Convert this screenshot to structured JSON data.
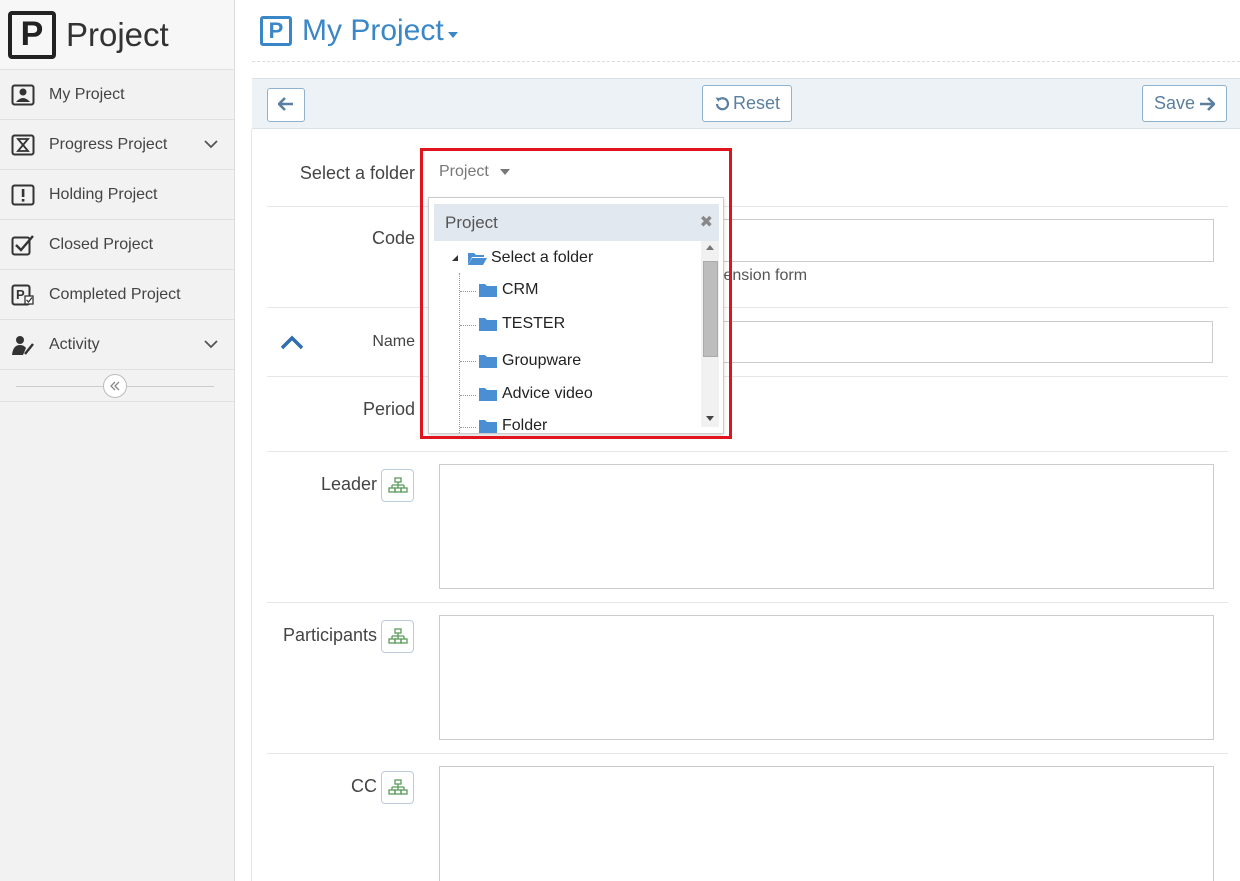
{
  "sidebar": {
    "brand_logo": "P",
    "brand_title": "Project",
    "items": [
      {
        "label": "My Project",
        "icon": "user-card-icon"
      },
      {
        "label": "Progress Project",
        "icon": "hourglass-icon",
        "expandable": true
      },
      {
        "label": "Holding Project",
        "icon": "exclamation-box-icon"
      },
      {
        "label": "Closed Project",
        "icon": "check-box-icon"
      },
      {
        "label": "Completed Project",
        "icon": "project-check-icon"
      },
      {
        "label": "Activity",
        "icon": "user-edit-icon",
        "expandable": true
      }
    ],
    "collapse_icon": "double-chevron-left-icon"
  },
  "header": {
    "logo": "P",
    "title": "My Project"
  },
  "toolbar": {
    "reset_label": "Reset",
    "save_label": "Save"
  },
  "form": {
    "folder_label": "Select a folder",
    "folder_value": "Project",
    "code_label": "Code",
    "code_hint": "tension form",
    "name_label": "Name",
    "period_label": "Period",
    "leader_label": "Leader",
    "participants_label": "Participants",
    "cc_label": "CC"
  },
  "dropdown": {
    "header": "Project",
    "root": "Select a folder",
    "folders": [
      "CRM",
      "TESTER",
      "Groupware",
      "Advice video",
      "Folder"
    ]
  },
  "colors": {
    "accent": "#3a87c8",
    "highlight": "#e0141c",
    "folder": "#4a8fd4"
  }
}
